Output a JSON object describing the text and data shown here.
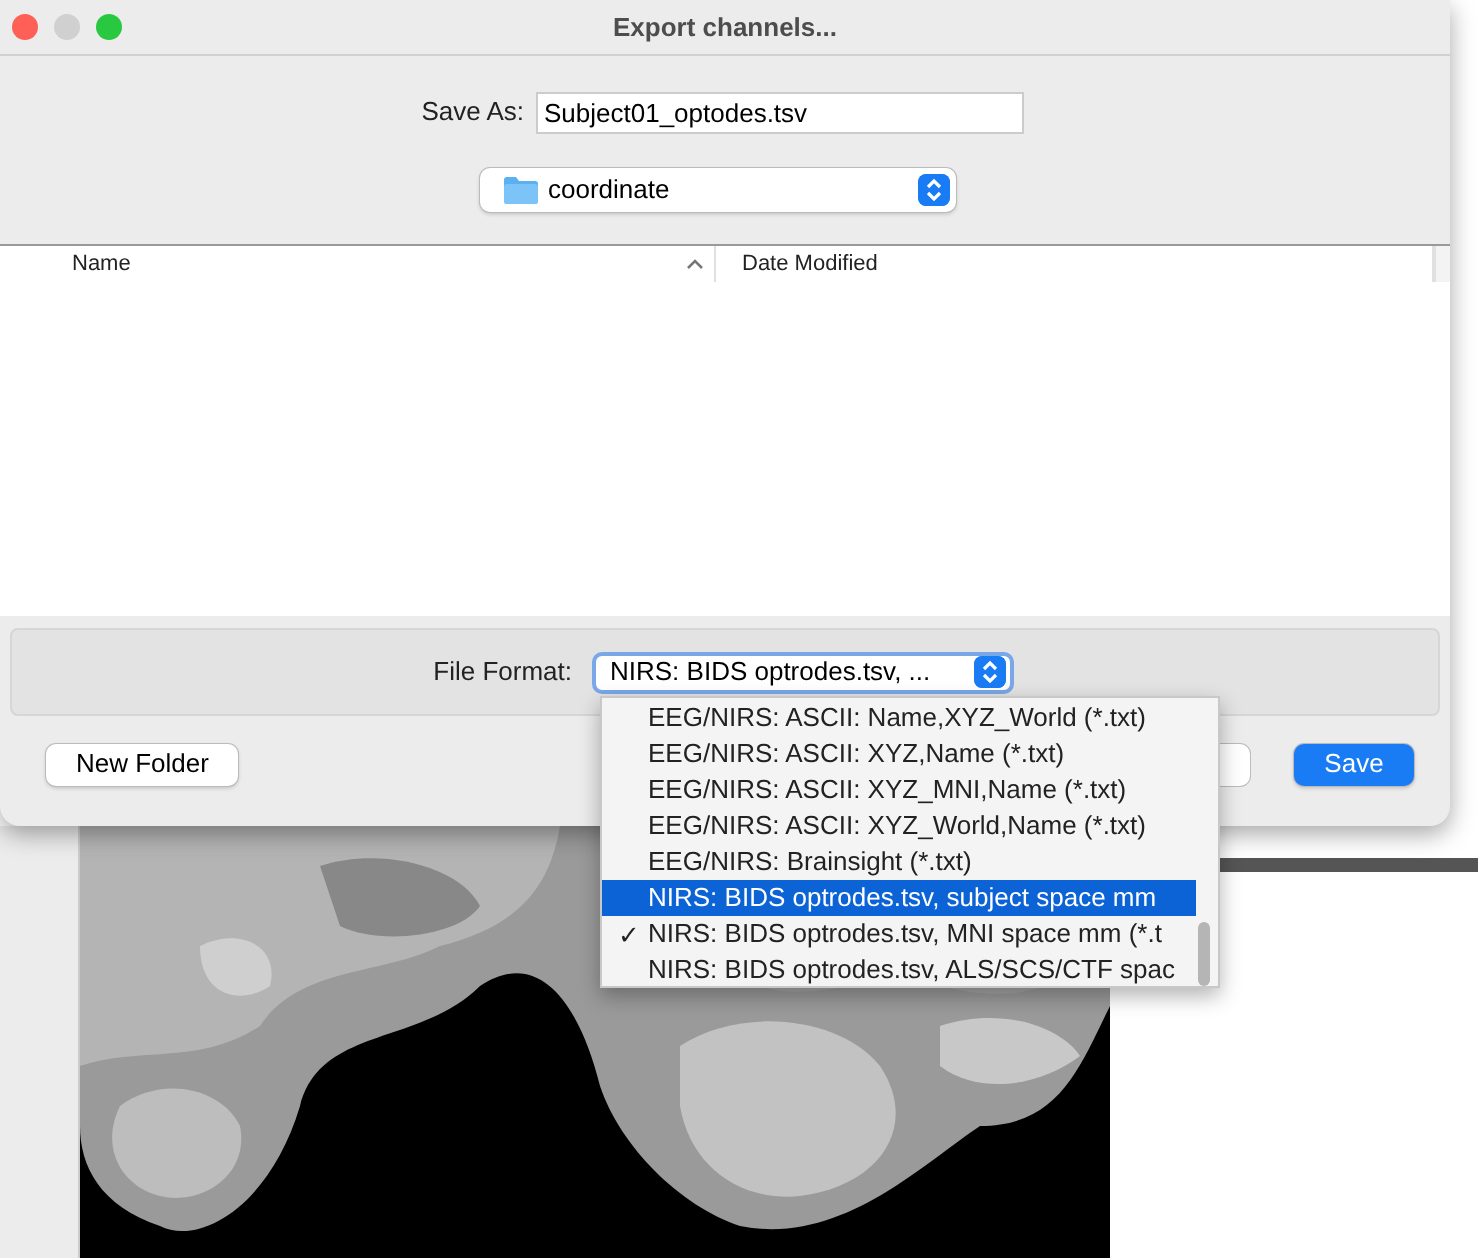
{
  "window": {
    "title": "Export channels..."
  },
  "save_as": {
    "label": "Save As:",
    "value": "Subject01_optodes.tsv"
  },
  "location": {
    "value": "coordinate"
  },
  "file_list": {
    "columns": [
      {
        "label": "Name",
        "sorted": true
      },
      {
        "label": "Date Modified",
        "sorted": false
      }
    ]
  },
  "file_format": {
    "label": "File Format:",
    "value": "NIRS: BIDS optrodes.tsv, ..."
  },
  "format_menu": [
    {
      "label": "EEG/NIRS: ASCII: Name,XYZ_World (*.txt)",
      "selected": false,
      "checked": false
    },
    {
      "label": "EEG/NIRS: ASCII: XYZ,Name (*.txt)",
      "selected": false,
      "checked": false
    },
    {
      "label": "EEG/NIRS: ASCII: XYZ_MNI,Name (*.txt)",
      "selected": false,
      "checked": false
    },
    {
      "label": "EEG/NIRS: ASCII: XYZ_World,Name (*.txt)",
      "selected": false,
      "checked": false
    },
    {
      "label": "EEG/NIRS: Brainsight (*.txt)",
      "selected": false,
      "checked": false
    },
    {
      "label": "NIRS: BIDS optrodes.tsv, subject space mm",
      "selected": true,
      "checked": false
    },
    {
      "label": "NIRS: BIDS optrodes.tsv, MNI space mm (*.t",
      "selected": false,
      "checked": true
    },
    {
      "label": "NIRS: BIDS optrodes.tsv, ALS/SCS/CTF spac",
      "selected": false,
      "checked": false
    }
  ],
  "check_mark": "✓",
  "buttons": [
    {
      "kind": "plain",
      "label": "New Folder"
    },
    {
      "kind": "default",
      "label": "Save"
    }
  ]
}
